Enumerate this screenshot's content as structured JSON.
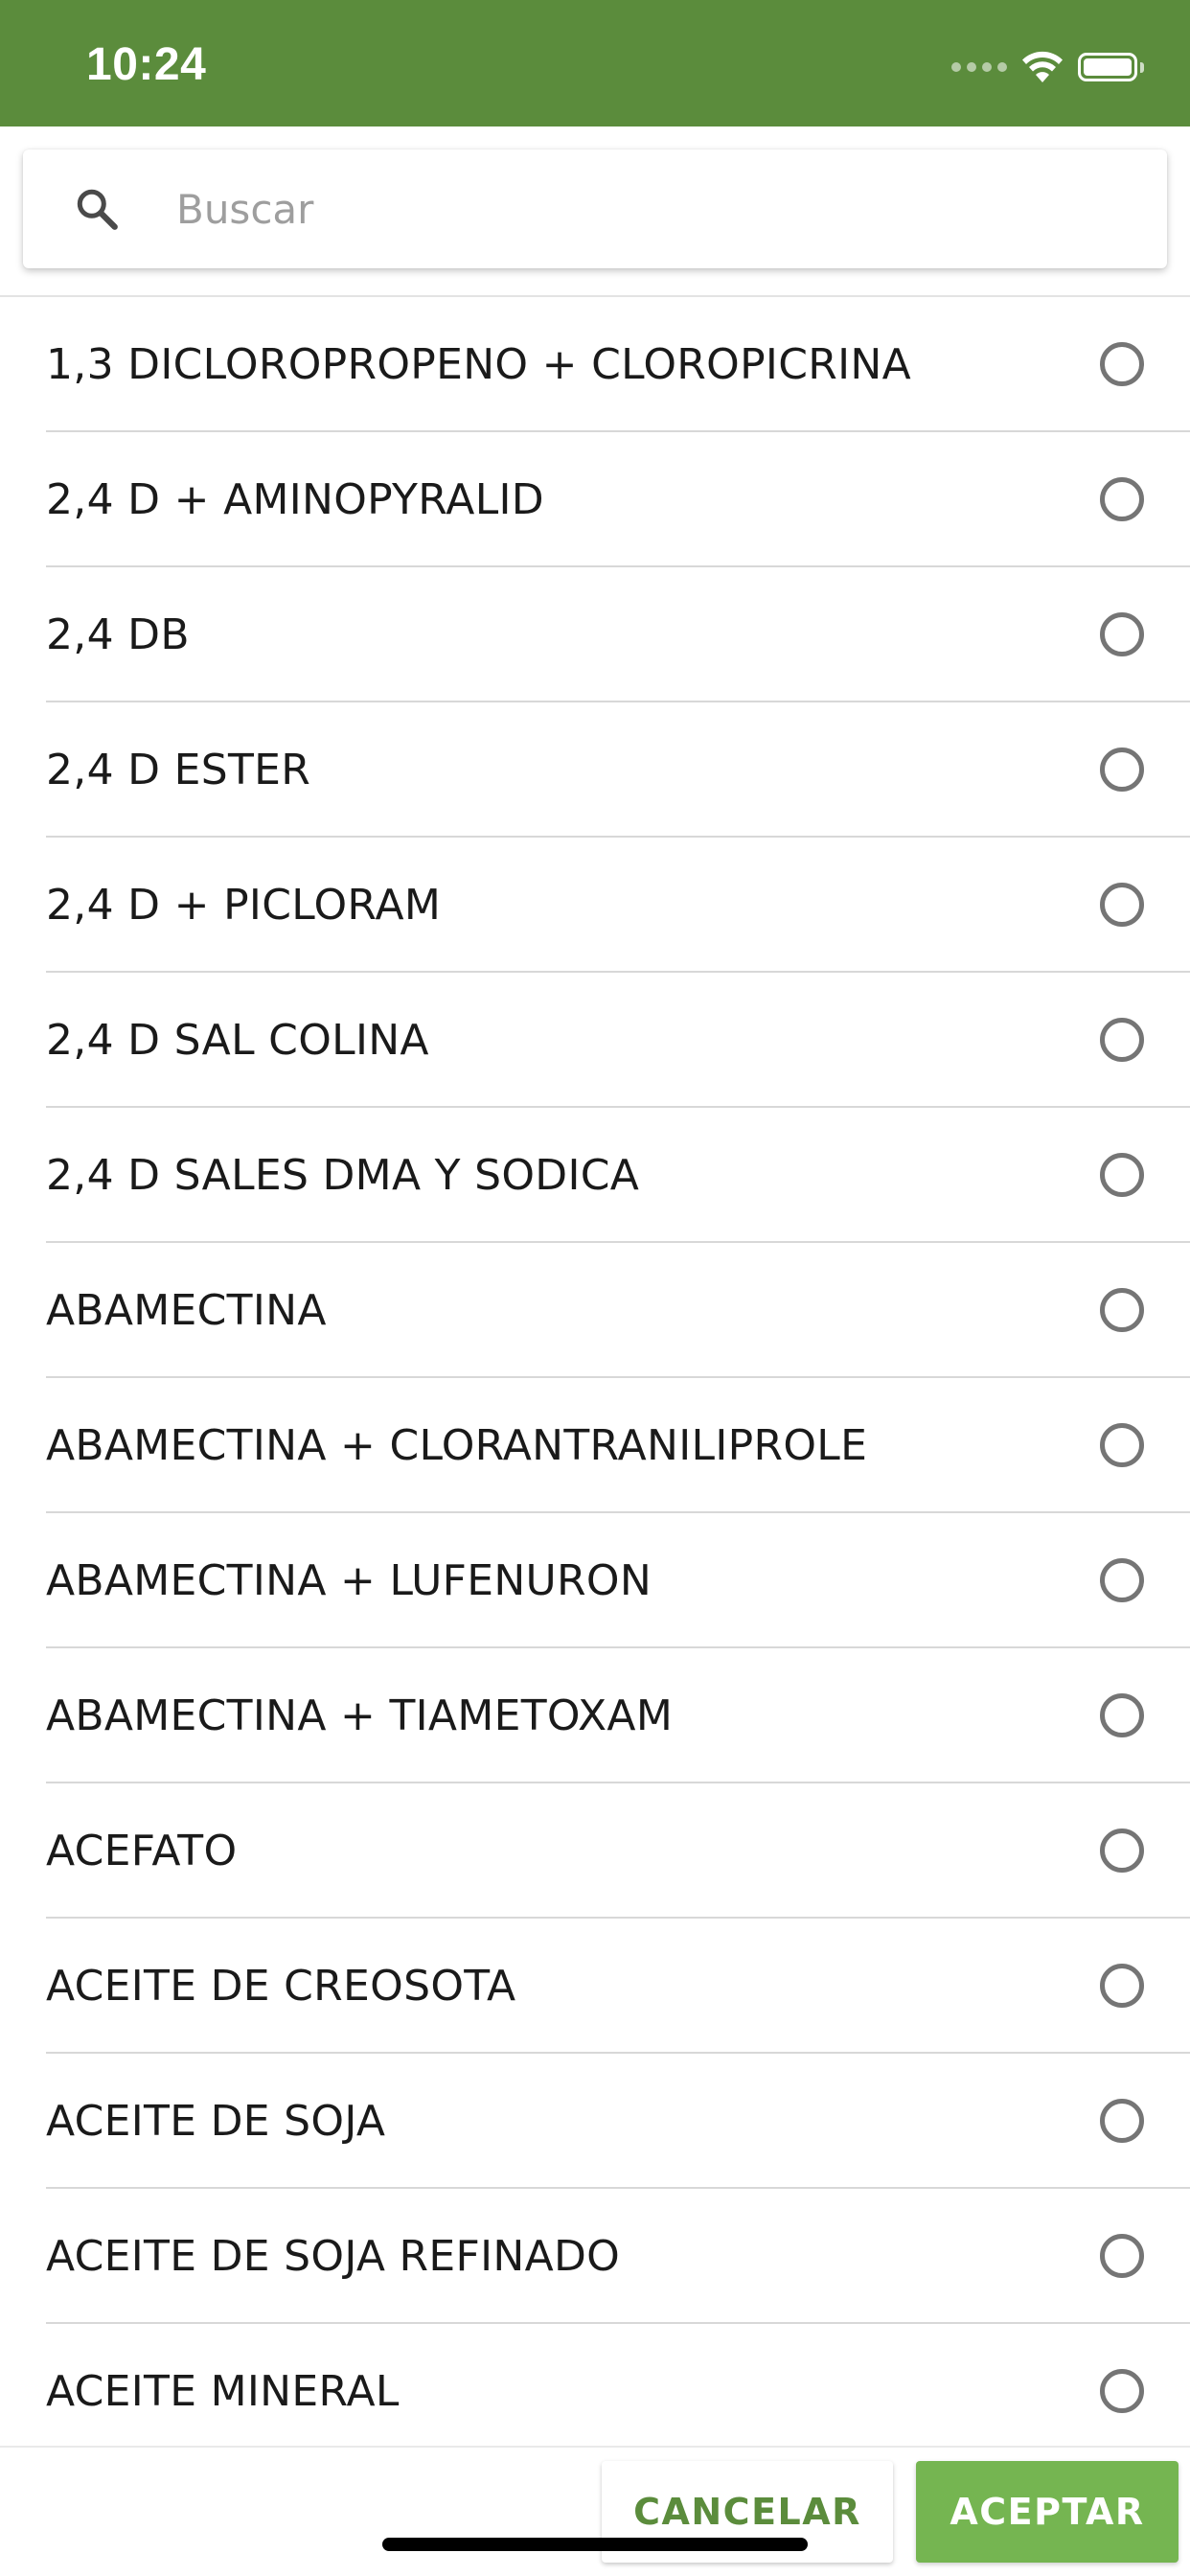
{
  "status_bar": {
    "time": "10:24",
    "background_color": "#5b8c3c"
  },
  "search": {
    "placeholder": "Buscar",
    "value": "",
    "icon": "search-icon"
  },
  "items": [
    {
      "label": "1,3 DICLOROPROPENO + CLOROPICRINA",
      "selected": false
    },
    {
      "label": "2,4 D + AMINOPYRALID",
      "selected": false
    },
    {
      "label": "2,4 DB",
      "selected": false
    },
    {
      "label": "2,4 D ESTER",
      "selected": false
    },
    {
      "label": "2,4 D + PICLORAM",
      "selected": false
    },
    {
      "label": "2,4 D SAL COLINA",
      "selected": false
    },
    {
      "label": "2,4 D SALES DMA Y SODICA",
      "selected": false
    },
    {
      "label": "ABAMECTINA",
      "selected": false
    },
    {
      "label": "ABAMECTINA + CLORANTRANILIPROLE",
      "selected": false
    },
    {
      "label": "ABAMECTINA + LUFENURON",
      "selected": false
    },
    {
      "label": "ABAMECTINA + TIAMETOXAM",
      "selected": false
    },
    {
      "label": "ACEFATO",
      "selected": false
    },
    {
      "label": "ACEITE DE CREOSOTA",
      "selected": false
    },
    {
      "label": "ACEITE DE SOJA",
      "selected": false
    },
    {
      "label": "ACEITE DE SOJA REFINADO",
      "selected": false
    },
    {
      "label": "ACEITE MINERAL",
      "selected": false
    }
  ],
  "actions": {
    "cancel_label": "CANCELAR",
    "accept_label": "ACEPTAR",
    "accent_color": "#75b551"
  }
}
